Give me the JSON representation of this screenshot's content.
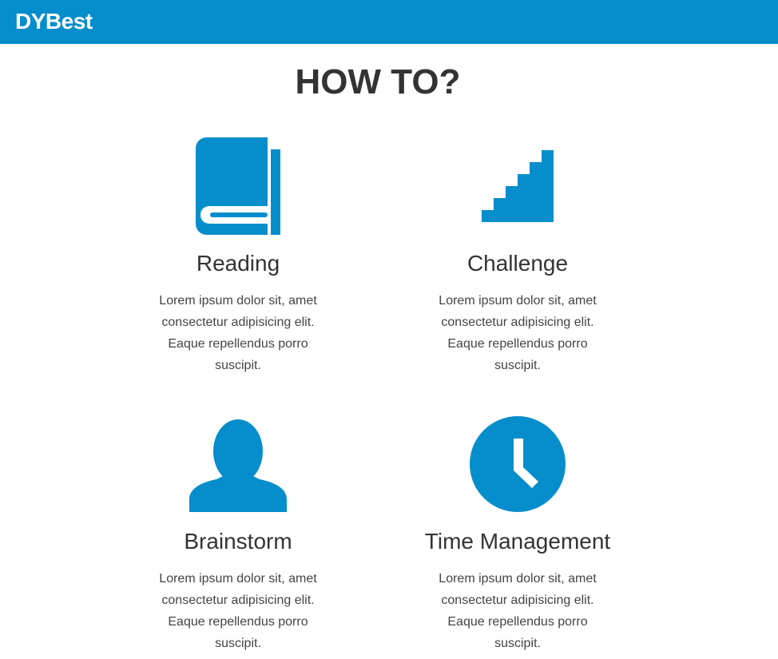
{
  "navbar": {
    "brand": "DYBest"
  },
  "page": {
    "title": "HOW TO?"
  },
  "features": [
    {
      "title": "Reading",
      "text": "Lorem ipsum dolor sit, amet consectetur adipisicing elit. Eaque repellendus porro suscipit.",
      "icon": "book-icon"
    },
    {
      "title": "Challenge",
      "text": "Lorem ipsum dolor sit, amet consectetur adipisicing elit. Eaque repellendus porro suscipit.",
      "icon": "stairs-icon"
    },
    {
      "title": "Brainstorm",
      "text": "Lorem ipsum dolor sit, amet consectetur adipisicing elit. Eaque repellendus porro suscipit.",
      "icon": "person-icon"
    },
    {
      "title": "Time Management",
      "text": "Lorem ipsum dolor sit, amet consectetur adipisicing elit. Eaque repellendus porro suscipit.",
      "icon": "clock-icon"
    }
  ],
  "colors": {
    "accent": "#068dcb",
    "text": "#333333",
    "background": "#ffffff"
  }
}
